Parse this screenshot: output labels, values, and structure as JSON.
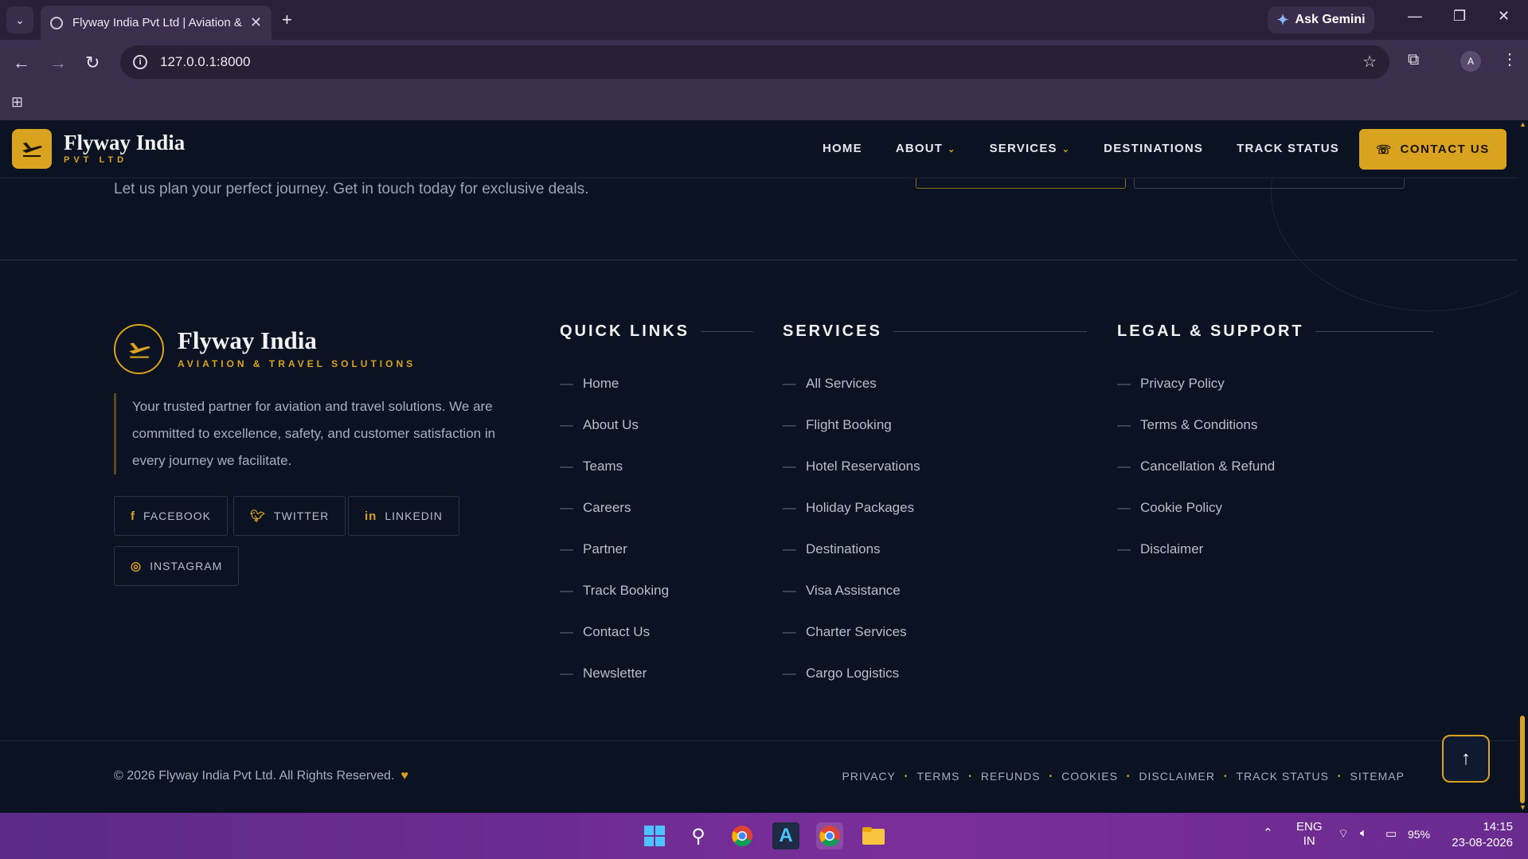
{
  "browser": {
    "tab_title": "Flyway India Pvt Ltd | Aviation &",
    "ask_gemini": "Ask Gemini",
    "url": "127.0.0.1:8000",
    "profile_initial": "A"
  },
  "site_nav": {
    "logo_name": "Flyway India",
    "logo_sub": "PVT LTD",
    "links": [
      "HOME",
      "ABOUT",
      "SERVICES",
      "DESTINATIONS",
      "TRACK STATUS"
    ],
    "contact_button": "CONTACT US"
  },
  "cta": {
    "text": "Let us plan your perfect journey. Get in touch today for exclusive deals."
  },
  "footer": {
    "brand_name": "Flyway India",
    "brand_sub": "AVIATION & TRAVEL SOLUTIONS",
    "description": "Your trusted partner for aviation and travel solutions. We are committed to excellence, safety, and customer satisfaction in every journey we facilitate.",
    "social": [
      "FACEBOOK",
      "TWITTER",
      "LINKEDIN",
      "INSTAGRAM"
    ],
    "quick_links_title": "QUICK LINKS",
    "quick_links": [
      "Home",
      "About Us",
      "Teams",
      "Careers",
      "Partner",
      "Track Booking",
      "Contact Us",
      "Newsletter"
    ],
    "services_title": "SERVICES",
    "services": [
      "All Services",
      "Flight Booking",
      "Hotel Reservations",
      "Holiday Packages",
      "Destinations",
      "Visa Assistance",
      "Charter Services",
      "Cargo Logistics"
    ],
    "legal_title": "LEGAL & SUPPORT",
    "legal": [
      "Privacy Policy",
      "Terms & Conditions",
      "Cancellation & Refund",
      "Cookie Policy",
      "Disclaimer"
    ],
    "copyright": "© 2026 Flyway India Pvt Ltd. All Rights Reserved.",
    "bottom_links": [
      "PRIVACY",
      "TERMS",
      "REFUNDS",
      "COOKIES",
      "DISCLAIMER",
      "TRACK STATUS",
      "SITEMAP"
    ]
  },
  "taskbar": {
    "lang": "ENG",
    "region": "IN",
    "battery": "95%",
    "time": "14:15",
    "date": "23-08-2026"
  },
  "colors": {
    "accent": "#d9a320",
    "background": "#0b1221",
    "taskbar": "#7a2e9a"
  }
}
